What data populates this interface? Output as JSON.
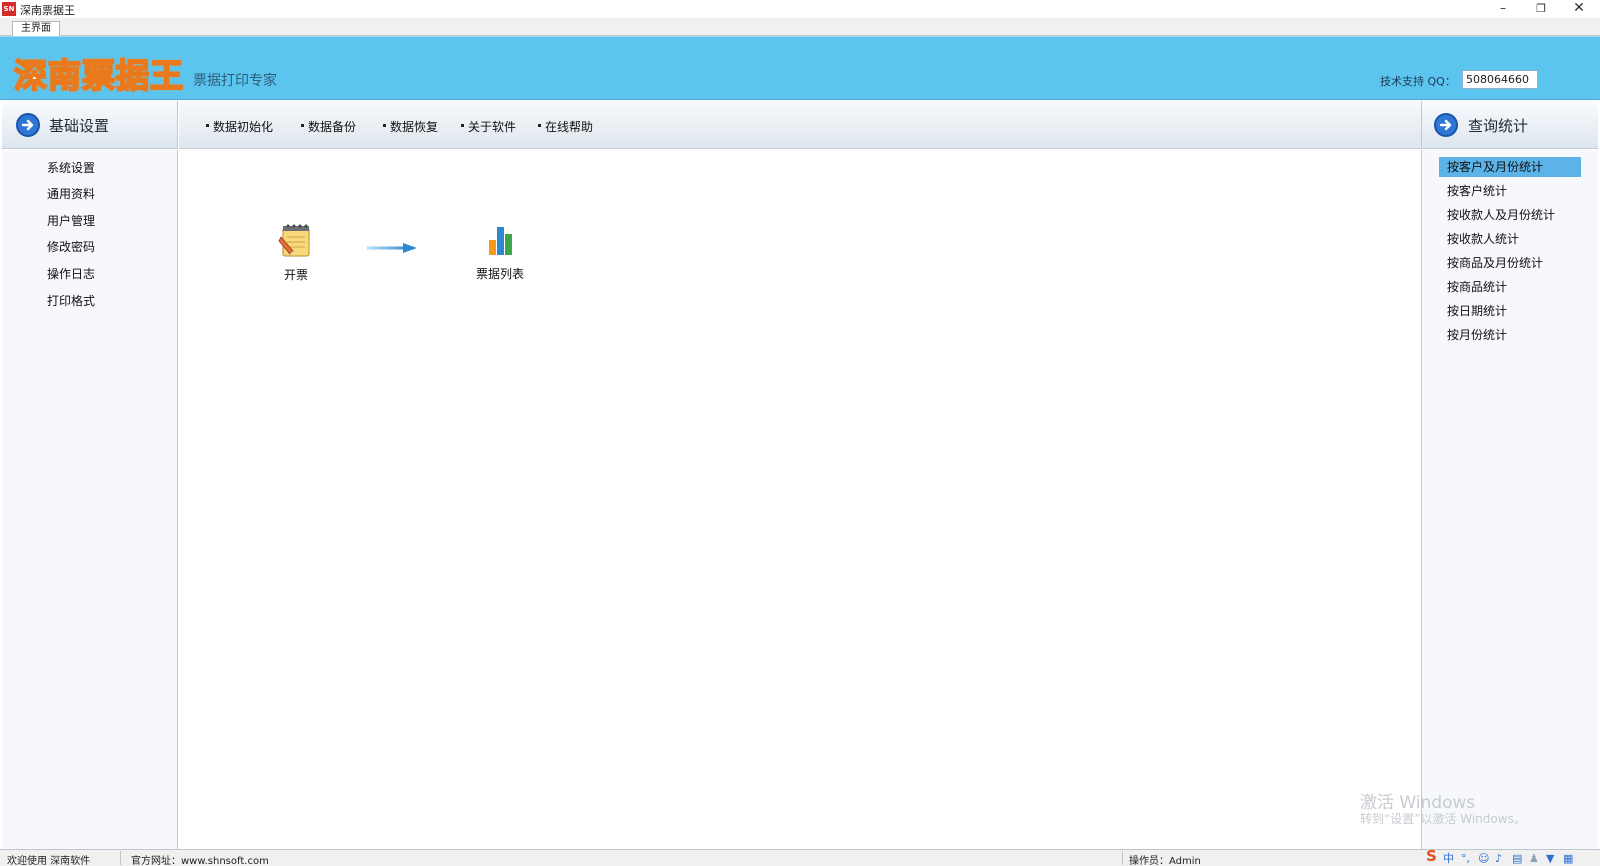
{
  "window": {
    "icon_text": "SN",
    "title": "深南票据王",
    "controls": {
      "minimize": "–",
      "restore": "❐",
      "close": "✕"
    }
  },
  "tabs": [
    {
      "label": "主界面"
    }
  ],
  "banner": {
    "logo": "深南票据王",
    "slogan": "票据打印专家",
    "support_label": "技术支持 QQ：",
    "support_qq": "508064660"
  },
  "left_panel": {
    "title": "基础设置",
    "items": [
      "系统设置",
      "通用资料",
      "用户管理",
      "修改密码",
      "操作日志",
      "打印格式"
    ]
  },
  "toolbar": {
    "items": [
      "数据初始化",
      "数据备份",
      "数据恢复",
      "关于软件",
      "在线帮助"
    ]
  },
  "right_panel": {
    "title": "查询统计",
    "selected_index": 0,
    "items": [
      "按客户及月份统计",
      "按客户统计",
      "按收款人及月份统计",
      "按收款人统计",
      "按商品及月份统计",
      "按商品统计",
      "按日期统计",
      "按月份统计"
    ]
  },
  "workspace": {
    "issue_ticket": {
      "label": "开票",
      "icon": "notepad-pencil-icon"
    },
    "ticket_list": {
      "label": "票据列表",
      "icon": "bar-chart-icon"
    },
    "flow_arrow": "arrow-right-icon"
  },
  "watermark": {
    "line1": "激活 Windows",
    "line2": "转到“设置”以激活 Windows。"
  },
  "statusbar": {
    "welcome": "欢迎使用 深南软件",
    "website": "官方网址：www.shnsoft.com",
    "operator": "操作员：Admin"
  },
  "tray": {
    "ime_logo": "S",
    "ime_lang": "中",
    "items": [
      "punctuation-icon",
      "emoji-icon",
      "microphone-icon",
      "keyboard-icon",
      "user-icon",
      "skin-icon",
      "grid-icon"
    ]
  },
  "colors": {
    "banner": "#5bc4ef",
    "selected": "#5bb3e8",
    "logo_stroke": "#e8791c",
    "arrow_circle": "#2e77d6"
  }
}
